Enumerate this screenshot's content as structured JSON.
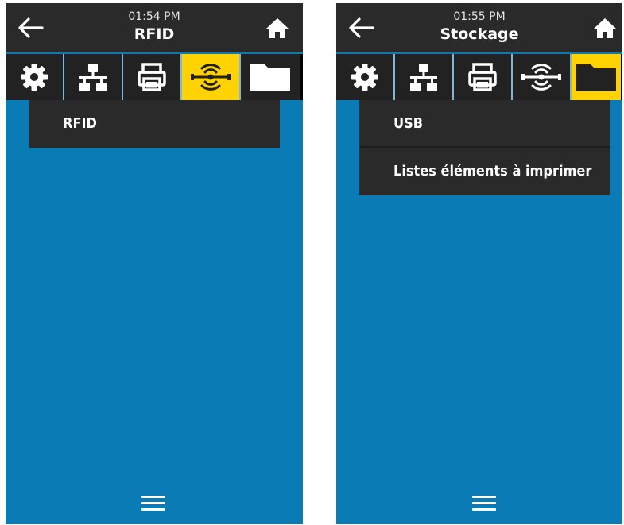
{
  "colors": {
    "header_bg": "#2a2a2a",
    "content_bg": "#0a7bb5",
    "active_tab": "#ffd200"
  },
  "screens": [
    {
      "time": "01:54 PM",
      "title": "RFID",
      "active_tab": "rfid",
      "tabs": [
        "settings-icon",
        "network-icon",
        "printer-icon",
        "rfid-icon",
        "folder-icon"
      ],
      "menu_items": [
        {
          "label": "RFID"
        }
      ]
    },
    {
      "time": "01:55 PM",
      "title": "Stockage",
      "active_tab": "storage",
      "tabs": [
        "settings-icon",
        "network-icon",
        "printer-icon",
        "rfid-icon",
        "folder-icon"
      ],
      "menu_items": [
        {
          "label": "USB"
        },
        {
          "label": "Listes éléments à imprimer"
        }
      ]
    }
  ]
}
